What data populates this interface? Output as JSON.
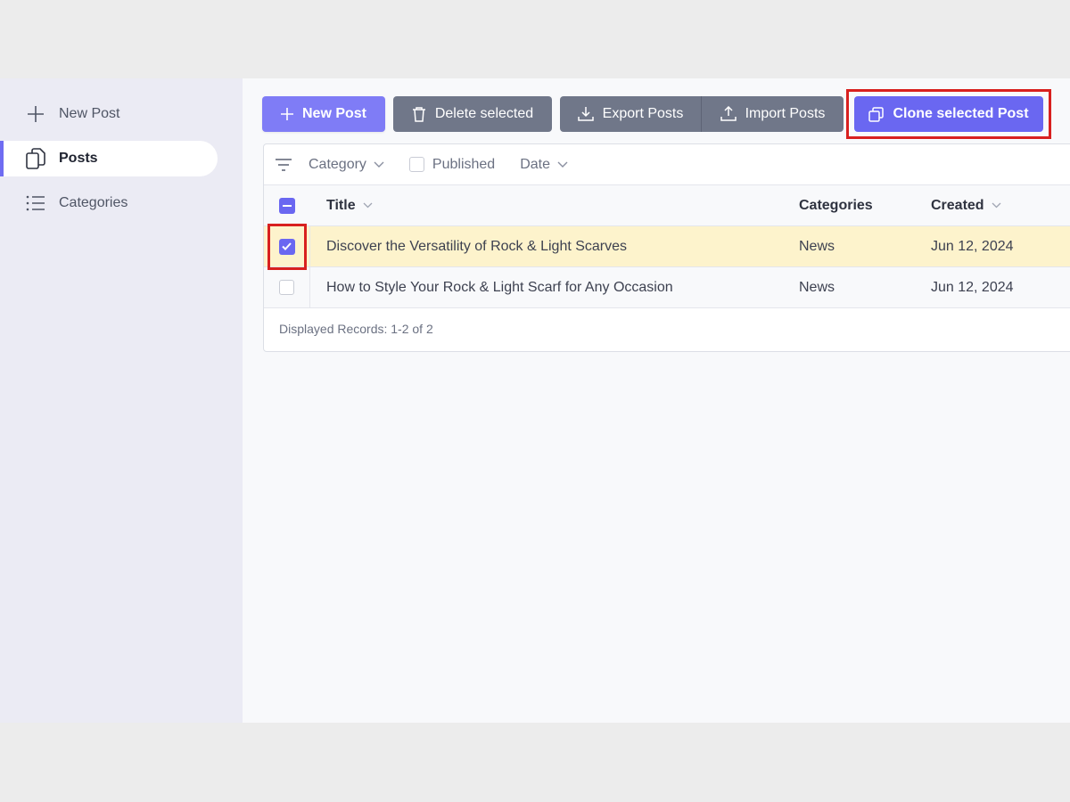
{
  "sidebar": {
    "items": [
      {
        "label": "New Post",
        "icon": "plus-icon",
        "active": false
      },
      {
        "label": "Posts",
        "icon": "documents-icon",
        "active": true
      },
      {
        "label": "Categories",
        "icon": "list-icon",
        "active": false
      }
    ]
  },
  "toolbar": {
    "new_post_label": "New Post",
    "delete_label": "Delete selected",
    "export_label": "Export Posts",
    "import_label": "Import Posts",
    "clone_label": "Clone selected Post"
  },
  "filters": {
    "category_label": "Category",
    "published_label": "Published",
    "date_label": "Date"
  },
  "table": {
    "columns": {
      "title": "Title",
      "categories": "Categories",
      "created": "Created"
    },
    "rows": [
      {
        "title": "Discover the Versatility of Rock & Light Scarves",
        "category": "News",
        "created": "Jun 12, 2024",
        "selected": true
      },
      {
        "title": "How to Style Your Rock & Light Scarf for Any Occasion",
        "category": "News",
        "created": "Jun 12, 2024",
        "selected": false
      }
    ],
    "footer": "Displayed Records: 1-2 of 2"
  },
  "colors": {
    "accent": "#6a67f1",
    "highlight": "#d8201f",
    "selected_row": "#fdf3cc"
  }
}
